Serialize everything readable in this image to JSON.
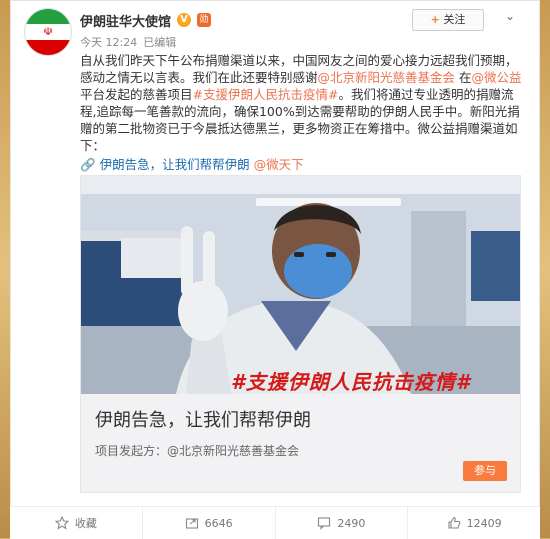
{
  "post": {
    "author": "伊朗驻华大使馆",
    "time": "今天 12:24",
    "edited": "已编辑",
    "follow_label": "关注",
    "verified_badge": "V",
    "medal_badge": "勋",
    "more_icon": "chevron-down-icon",
    "body": {
      "line_a": "自从我们昨天下午公布捐赠渠道以来，中国网友之间的爱心接力远超我们预期，感动之情无以言表。我们在此还要特别感谢",
      "mention_a": "@北京新阳光慈善基金会",
      "line_b": " 在",
      "mention_b": "@微公益",
      "line_c": "平台发起的慈善项目",
      "hashtag": "#支援伊朗人民抗击疫情#",
      "line_d": "。我们将通过专业透明的捐赠流程,追踪每一笔善款的流向，确保100%到达需要帮助的伊朗人民手中。新阳光捐赠的第二批物资已于今晨抵达德黑兰，更多物资正在筹措中。微公益捐赠渠道如下：",
      "link_text": "伊朗告急，让我们帮帮伊朗",
      "mention_c": "@微天下"
    },
    "card": {
      "overlay_text": "#支援伊朗人民抗击疫情#",
      "title": "伊朗告急，让我们帮帮伊朗",
      "sponsor_prefix": "项目发起方：",
      "sponsor": "@北京新阳光慈善基金会",
      "join_label": "参与"
    },
    "actions": [
      {
        "icon": "star-icon",
        "label": "收藏"
      },
      {
        "icon": "share-icon",
        "label": "6646"
      },
      {
        "icon": "comment-icon",
        "label": "2490"
      },
      {
        "icon": "thumbs-up-icon",
        "label": "12409"
      }
    ],
    "colors": {
      "accent": "#eb7350",
      "button": "#f77c3d",
      "mask": "#4a8fd6"
    }
  }
}
